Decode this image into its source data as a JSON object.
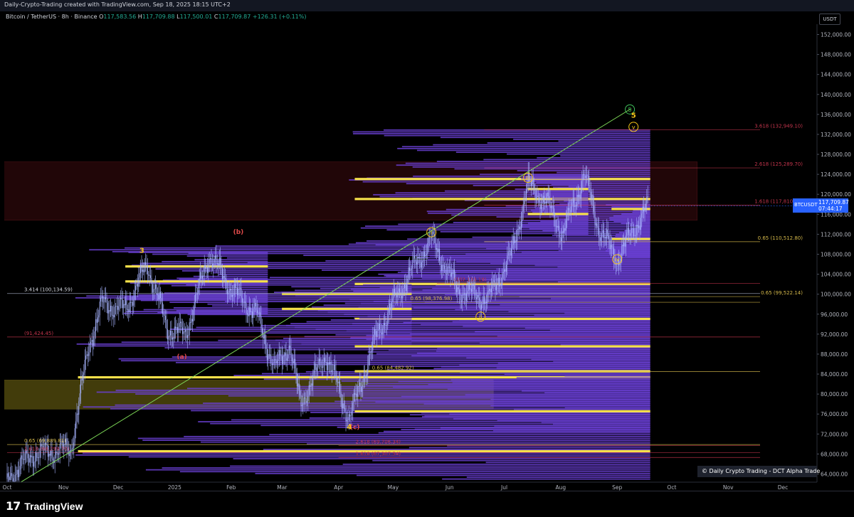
{
  "header": {
    "title": "Daily-Crypto-Trading created with TradingView.com, Sep 18, 2025 18:15 UTC+2"
  },
  "legend": {
    "symbol": "Bitcoin / TetherUS · 8h · Binance",
    "o_label": "O",
    "o_value": "117,583.56",
    "h_label": "H",
    "h_value": "117,709.88",
    "l_label": "L",
    "l_value": "117,500.01",
    "c_label": "C",
    "c_value": "117,709.87",
    "change": "+126.31 (+0.11%)"
  },
  "currency_label": "USDT",
  "price_tag": {
    "symbol": "BTCUSDT",
    "price": "117,709.87",
    "countdown": "07:44:17"
  },
  "watermark": "© Daily Crypto Trading - DCT Alpha Trade",
  "brand": {
    "logo": "17",
    "name": "TradingView"
  },
  "colors": {
    "background": "#000000",
    "candle": "#a7b4ff",
    "volume_profile": "#6a3fd4",
    "volume_poc": "#f5e04a",
    "trendline": "#7ed957",
    "fib_red": "#c0344b",
    "fib_gold": "#d4b84a",
    "wave_yellow": "#f5c518",
    "wave_red": "#e04a4a",
    "wave_green": "#3fbf5a",
    "price_tag": "#2962ff"
  },
  "chart_data": {
    "type": "candlestick",
    "title": "",
    "xlabel": "",
    "ylabel": "",
    "ylim": [
      62000,
      154000
    ],
    "y_ticks": [
      "152,000.00",
      "148,000.00",
      "144,000.00",
      "140,000.00",
      "136,000.00",
      "132,000.00",
      "128,000.00",
      "124,000.00",
      "120,000.00",
      "116,000.00",
      "112,000.00",
      "108,000.00",
      "104,000.00",
      "100,000.00",
      "96,000.00",
      "92,000.00",
      "88,000.00",
      "84,000.00",
      "80,000.00",
      "76,000.00",
      "72,000.00",
      "68,000.00",
      "64,000.00"
    ],
    "y_tick_values": [
      152000,
      148000,
      144000,
      140000,
      136000,
      132000,
      128000,
      124000,
      120000,
      116000,
      112000,
      108000,
      104000,
      100000,
      96000,
      92000,
      88000,
      84000,
      80000,
      76000,
      72000,
      68000,
      64000
    ],
    "x_ticks": [
      "Oct",
      "Nov",
      "Dec",
      "2025",
      "Feb",
      "Mar",
      "Apr",
      "May",
      "Jun",
      "Jul",
      "Aug",
      "Sep",
      "Oct",
      "Nov",
      "Dec"
    ],
    "x_tick_times": [
      "2024-10-01",
      "2024-11-01",
      "2024-12-01",
      "2025-01-01",
      "2025-02-01",
      "2025-03-01",
      "2025-04-01",
      "2025-05-01",
      "2025-06-01",
      "2025-07-01",
      "2025-08-01",
      "2025-09-01",
      "2025-10-01",
      "2025-11-01",
      "2025-12-01"
    ],
    "price_path": [
      [
        "2024-10-01",
        63000
      ],
      [
        "2024-10-15",
        68000
      ],
      [
        "2024-11-05",
        69000
      ],
      [
        "2024-11-15",
        90000
      ],
      [
        "2024-11-22",
        98000
      ],
      [
        "2024-12-05",
        97000
      ],
      [
        "2024-12-17",
        106000
      ],
      [
        "2024-12-28",
        93000
      ],
      [
        "2025-01-07",
        92000
      ],
      [
        "2025-01-20",
        108000
      ],
      [
        "2025-02-01",
        101000
      ],
      [
        "2025-02-15",
        96000
      ],
      [
        "2025-02-25",
        85000
      ],
      [
        "2025-03-05",
        90000
      ],
      [
        "2025-03-11",
        78000
      ],
      [
        "2025-03-25",
        88000
      ],
      [
        "2025-04-07",
        75000
      ],
      [
        "2025-04-22",
        92000
      ],
      [
        "2025-05-08",
        103000
      ],
      [
        "2025-05-22",
        111000
      ],
      [
        "2025-06-05",
        101000
      ],
      [
        "2025-06-22",
        99000
      ],
      [
        "2025-07-05",
        108000
      ],
      [
        "2025-07-14",
        122000
      ],
      [
        "2025-07-25",
        118000
      ],
      [
        "2025-08-02",
        112000
      ],
      [
        "2025-08-14",
        124000
      ],
      [
        "2025-08-22",
        113000
      ],
      [
        "2025-09-01",
        107000
      ],
      [
        "2025-09-10",
        113000
      ],
      [
        "2025-09-18",
        117709.87
      ]
    ],
    "trendline": {
      "from": [
        "2024-11-05",
        68500
      ],
      "to": [
        "2025-09-08",
        137000
      ]
    },
    "fib_levels": [
      {
        "label": "3.618 (132,949.10)",
        "value": 132949.1,
        "color": "red",
        "from": "2025-06-20"
      },
      {
        "label": "2.618 (125,289.70)",
        "value": 125289.7,
        "color": "red",
        "from": "2025-06-20"
      },
      {
        "label": "1.618 (117,810.30)",
        "value": 117810.3,
        "color": "red",
        "from": "2025-06-20"
      },
      {
        "label": "0.65 (110,512.80)",
        "value": 110512.8,
        "color": "gold",
        "from": "2025-06-20"
      },
      {
        "label": "3.414 (100,134.59)",
        "value": 100134.59,
        "color": "gray",
        "from": "2024-10-01"
      },
      {
        "label": "0.65 (99,522.14)",
        "value": 99522.14,
        "color": "gold",
        "from": "2025-06-20"
      },
      {
        "label": "0.65 (98,376.98)",
        "value": 98376.98,
        "color": "gold",
        "from": "2025-05-01"
      },
      {
        "label": "(91,424.45)",
        "value": 91424.45,
        "color": "red",
        "from": "2024-10-01"
      },
      {
        "label": "0.65 (84,482.92)",
        "value": 84482.92,
        "color": "gold",
        "from": "2025-04-10"
      },
      {
        "label": "0.65 (69,889.81)",
        "value": 69889.81,
        "color": "gold",
        "from": "2024-10-01"
      },
      {
        "label": "2.618 (69,706.34)",
        "value": 69706.34,
        "color": "red",
        "from": "2025-04-01"
      },
      {
        "label": "1.618 (68,299.70)",
        "value": 68299.7,
        "color": "red",
        "from": "2024-10-01"
      },
      {
        "label": "1.618 (67,307.54)",
        "value": 67307.54,
        "color": "red",
        "from": "2025-04-01"
      },
      {
        "label": "(102,133.19)",
        "value": 102133.19,
        "color": "red",
        "from": "2025-05-25"
      }
    ],
    "zones": [
      {
        "name": "resistance-zone",
        "from": "2024-10-01",
        "to": "2025-10-15",
        "y_from": 114800,
        "y_to": 126500,
        "color": "red"
      },
      {
        "name": "support-zone",
        "from": "2024-10-01",
        "to": "2025-06-25",
        "y_from": 77000,
        "y_to": 82800,
        "color": "olive"
      }
    ],
    "wave_labels": [
      {
        "text": "5",
        "time": "2025-09-08",
        "value": 137000,
        "style": "circle-green"
      },
      {
        "text": "5",
        "time": "2025-09-10",
        "value": 135800,
        "style": "yellow"
      },
      {
        "text": "v",
        "time": "2025-09-10",
        "value": 133500,
        "style": "circle-yellow"
      },
      {
        "text": "iii",
        "time": "2025-07-14",
        "value": 123300,
        "style": "circle-yellow"
      },
      {
        "text": "i",
        "time": "2025-05-22",
        "value": 112400,
        "style": "circle-yellow"
      },
      {
        "text": "ii",
        "time": "2025-06-18",
        "value": 95500,
        "style": "circle-yellow"
      },
      {
        "text": "iv",
        "time": "2025-09-01",
        "value": 107000,
        "style": "circle-yellow"
      },
      {
        "text": "3",
        "time": "2024-12-14",
        "value": 108700,
        "style": "yellow"
      },
      {
        "text": "(b)",
        "time": "2025-02-05",
        "value": 112500,
        "style": "red"
      },
      {
        "text": "(a)",
        "time": "2025-01-05",
        "value": 87500,
        "style": "red"
      },
      {
        "text": "(c)",
        "time": "2025-04-10",
        "value": 73400,
        "style": "red"
      },
      {
        "text": "4",
        "time": "2025-04-07",
        "value": 73400,
        "style": "yellow"
      }
    ],
    "volume_profiles": [
      {
        "anchor": "2024-11-05",
        "right": "2025-09-18",
        "y_from": 63000,
        "y_to": 110500,
        "poc": [
          68500,
          83300
        ]
      },
      {
        "anchor": "2025-04-06",
        "right": "2025-09-18",
        "y_from": 72500,
        "y_to": 133000,
        "poc": [
          76500,
          84500,
          89500,
          95000,
          102000,
          123000,
          119000
        ]
      },
      {
        "anchor": "2024-12-01",
        "right": "2025-02-20",
        "y_from": 96000,
        "y_to": 108500,
        "poc": [
          105500,
          102500
        ]
      },
      {
        "anchor": "2025-02-25",
        "right": "2025-05-10",
        "y_from": 90000,
        "y_to": 102000,
        "poc": [
          100000,
          97000
        ]
      },
      {
        "anchor": "2025-07-10",
        "right": "2025-08-15",
        "y_from": 112000,
        "y_to": 124000,
        "poc": [
          121000,
          116000
        ]
      },
      {
        "anchor": "2025-08-25",
        "right": "2025-09-18",
        "y_from": 107500,
        "y_to": 118000,
        "poc": [
          117000,
          111000
        ]
      }
    ],
    "grid": false,
    "legend": "none"
  }
}
